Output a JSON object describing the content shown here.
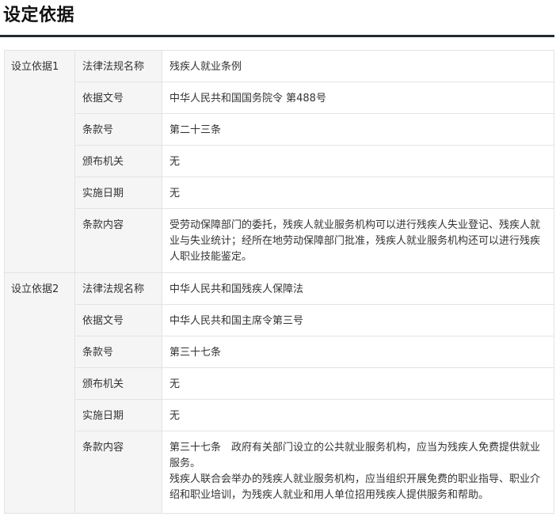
{
  "page": {
    "title": "设定依据"
  },
  "bases": [
    {
      "group_label": "设立依据1",
      "rows": [
        {
          "label": "法律法规名称",
          "value": "残疾人就业条例"
        },
        {
          "label": "依据文号",
          "value": "中华人民共和国国务院令 第488号"
        },
        {
          "label": "条款号",
          "value": "第二十三条"
        },
        {
          "label": "颁布机关",
          "value": "无"
        },
        {
          "label": "实施日期",
          "value": "无"
        },
        {
          "label": "条款内容",
          "paragraphs": [
            "受劳动保障部门的委托，残疾人就业服务机构可以进行残疾人失业登记、残疾人就业与失业统计；经所在地劳动保障部门批准，残疾人就业服务机构还可以进行残疾人职业技能鉴定。"
          ]
        }
      ]
    },
    {
      "group_label": "设立依据2",
      "rows": [
        {
          "label": "法律法规名称",
          "value": "中华人民共和国残疾人保障法"
        },
        {
          "label": "依据文号",
          "value": "中华人民共和国主席令第三号"
        },
        {
          "label": "条款号",
          "value": "第三十七条"
        },
        {
          "label": "颁布机关",
          "value": "无"
        },
        {
          "label": "实施日期",
          "value": "无"
        },
        {
          "label": "条款内容",
          "paragraphs": [
            "第三十七条　政府有关部门设立的公共就业服务机构，应当为残疾人免费提供就业服务。",
            "残疾人联合会举办的残疾人就业服务机构，应当组织开展免费的职业指导、职业介绍和职业培训，为残疾人就业和用人单位招用残疾人提供服务和帮助。"
          ]
        }
      ]
    }
  ]
}
